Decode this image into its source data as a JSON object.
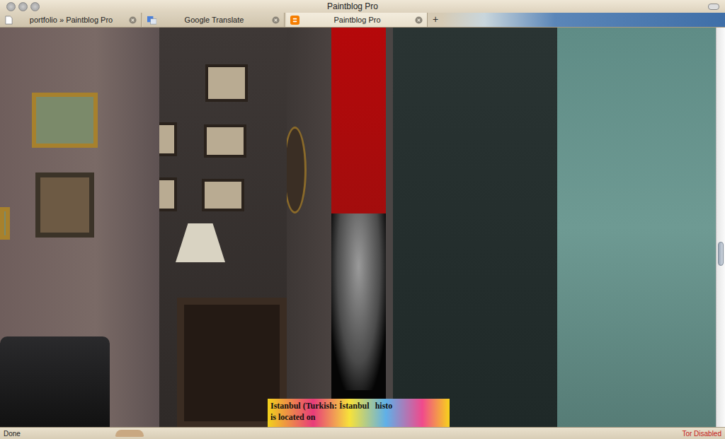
{
  "window": {
    "title": "Paintblog Pro"
  },
  "tabs": [
    {
      "label": "portfolio » Paintblog Pro",
      "selected": false,
      "kind": "page"
    },
    {
      "label": "Google Translate",
      "selected": false,
      "kind": "translate"
    },
    {
      "label": "Paintblog Pro",
      "selected": true,
      "kind": "blogger"
    }
  ],
  "new_tab": "+",
  "page": {
    "caption": {
      "line1": [
        "Istanbul (Turkish: İstanbul",
        "histo"
      ],
      "line2": "is located on"
    }
  },
  "scrollbar": {
    "level": 0.57
  },
  "status_bar": {
    "left": "Done",
    "right": "Tor Disabled"
  }
}
